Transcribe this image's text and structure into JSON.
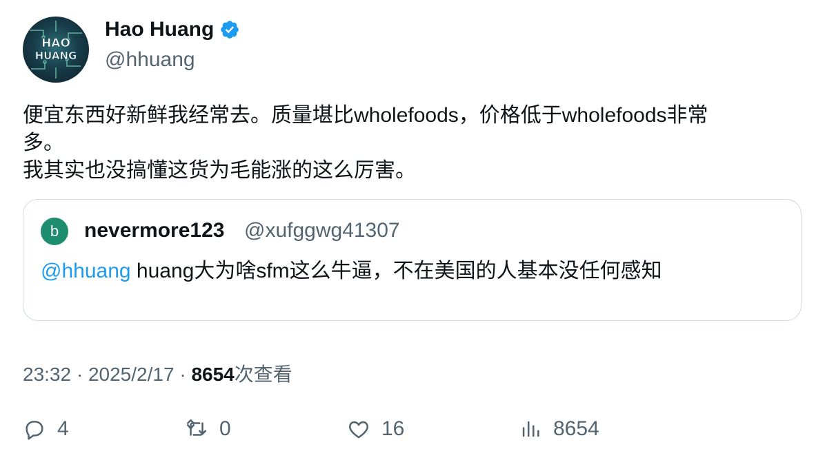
{
  "author": {
    "avatar_text_line1": "HAO",
    "avatar_text_line2": "HUANG",
    "display_name": "Hao Huang",
    "handle": "@hhuang",
    "verified_icon": "verified-badge-icon"
  },
  "tweet": {
    "lines": [
      "便宜东西好新鲜我经常去。质量堪比wholefoods，价格低于wholefoods非常",
      "多。",
      "我其实也没搞懂这货为毛能涨的这么厉害。"
    ]
  },
  "quote": {
    "avatar_letter": "b",
    "display_name": "nevermore123",
    "handle": "@xufggwg41307",
    "mention": "@hhuang",
    "text": " huang大为啥sfm这么牛逼，不在美国的人基本没任何感知"
  },
  "meta": {
    "time": "23:32",
    "sep1": " · ",
    "date": "2025/2/17",
    "sep2": " · ",
    "views_count": "8654",
    "views_label": "次查看"
  },
  "actions": {
    "replies": "4",
    "retweets": "0",
    "likes": "16",
    "views": "8654"
  },
  "colors": {
    "accent": "#1d9bf0",
    "muted": "#536471",
    "border": "#cfd9de",
    "quote_avatar": "#1e8c6e"
  }
}
